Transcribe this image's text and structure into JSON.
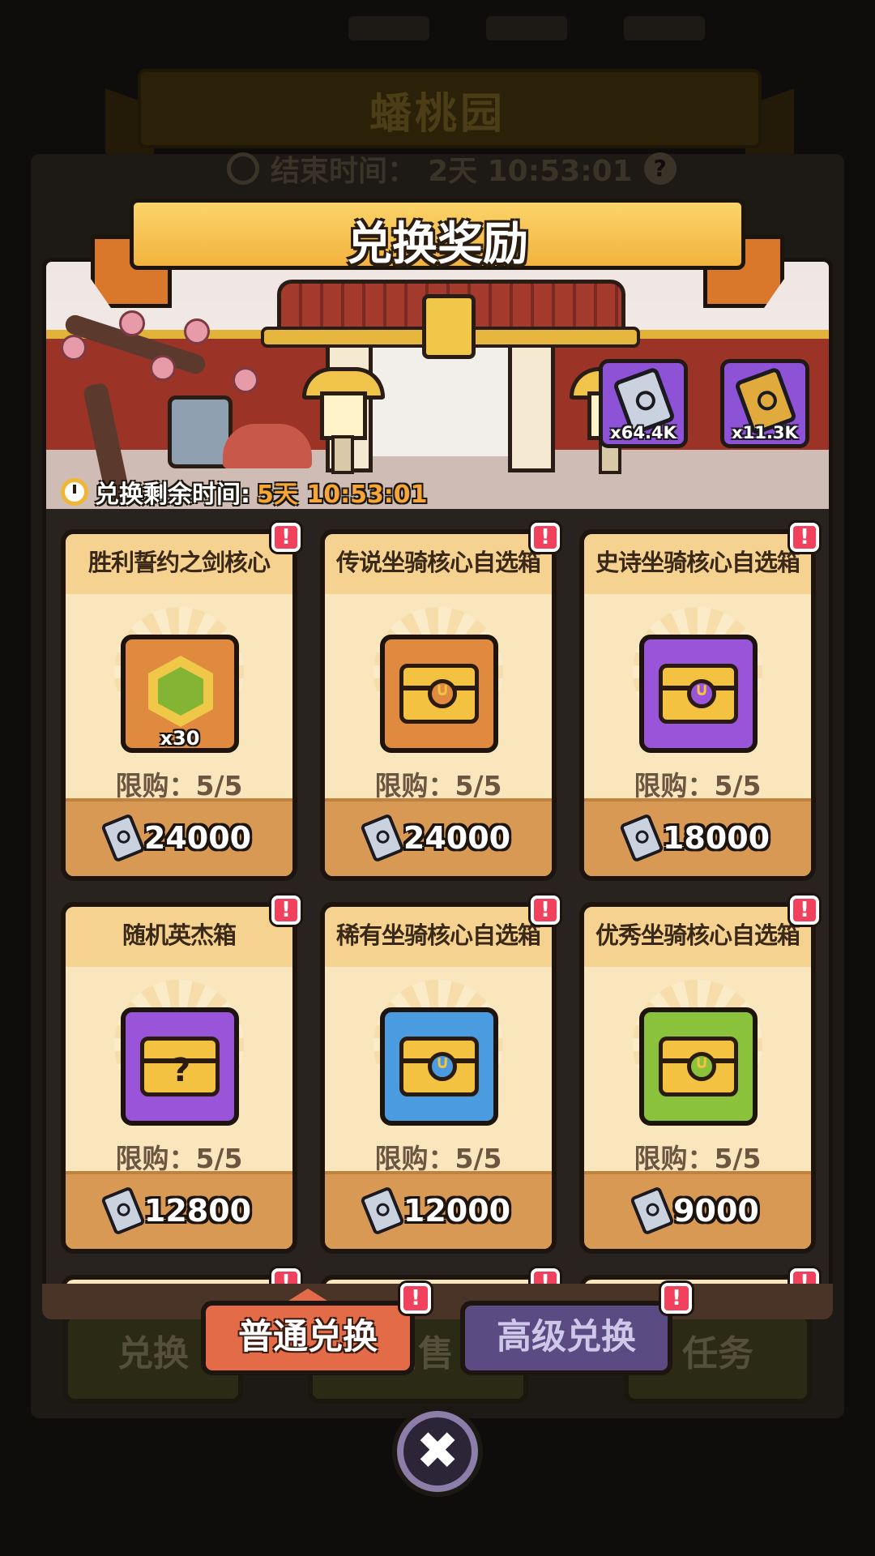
{
  "background": {
    "event_title": "蟠桃园",
    "end_time_label": "结束时间：",
    "end_time_value": "2天 10:53:01",
    "help_icon": "question-mark-icon",
    "tabs": [
      "兑换",
      "出售",
      "任务"
    ]
  },
  "dialog": {
    "title": "兑换奖励",
    "currencies": [
      {
        "icon": "silver-scroll-icon",
        "count": "x64.4K"
      },
      {
        "icon": "gold-scroll-icon",
        "count": "x11.3K"
      }
    ],
    "timer_label": "兑换剩余时间:",
    "timer_value": "5天 10:53:01",
    "items": [
      {
        "title": "胜利誓约之剑核心",
        "icon": "sword-core-icon",
        "rarity": "orange",
        "qty": "x30",
        "limit": "限购：5/5",
        "price": "24000"
      },
      {
        "title": "传说坐骑核心自选箱",
        "icon": "chest-icon",
        "rarity": "orange",
        "qty": "",
        "limit": "限购：5/5",
        "price": "24000"
      },
      {
        "title": "史诗坐骑核心自选箱",
        "icon": "chest-icon",
        "rarity": "purple",
        "qty": "",
        "limit": "限购：5/5",
        "price": "18000"
      },
      {
        "title": "随机英杰箱",
        "icon": "mystery-chest-icon",
        "rarity": "purple",
        "qty": "",
        "limit": "限购：5/5",
        "price": "12800"
      },
      {
        "title": "稀有坐骑核心自选箱",
        "icon": "chest-icon",
        "rarity": "blue",
        "qty": "",
        "limit": "限购：5/5",
        "price": "12000"
      },
      {
        "title": "优秀坐骑核心自选箱",
        "icon": "chest-icon",
        "rarity": "green",
        "qty": "",
        "limit": "限购：5/5",
        "price": "9000"
      }
    ],
    "badge_symbol": "!",
    "tabs": {
      "normal": "普通兑换",
      "advanced": "高级兑换"
    },
    "close_symbol": "✖"
  },
  "colors": {
    "accent_orange": "#e36b48",
    "header_gold": "#f2b33e",
    "alert_red": "#f1415d",
    "timer_orange": "#f7a534"
  }
}
